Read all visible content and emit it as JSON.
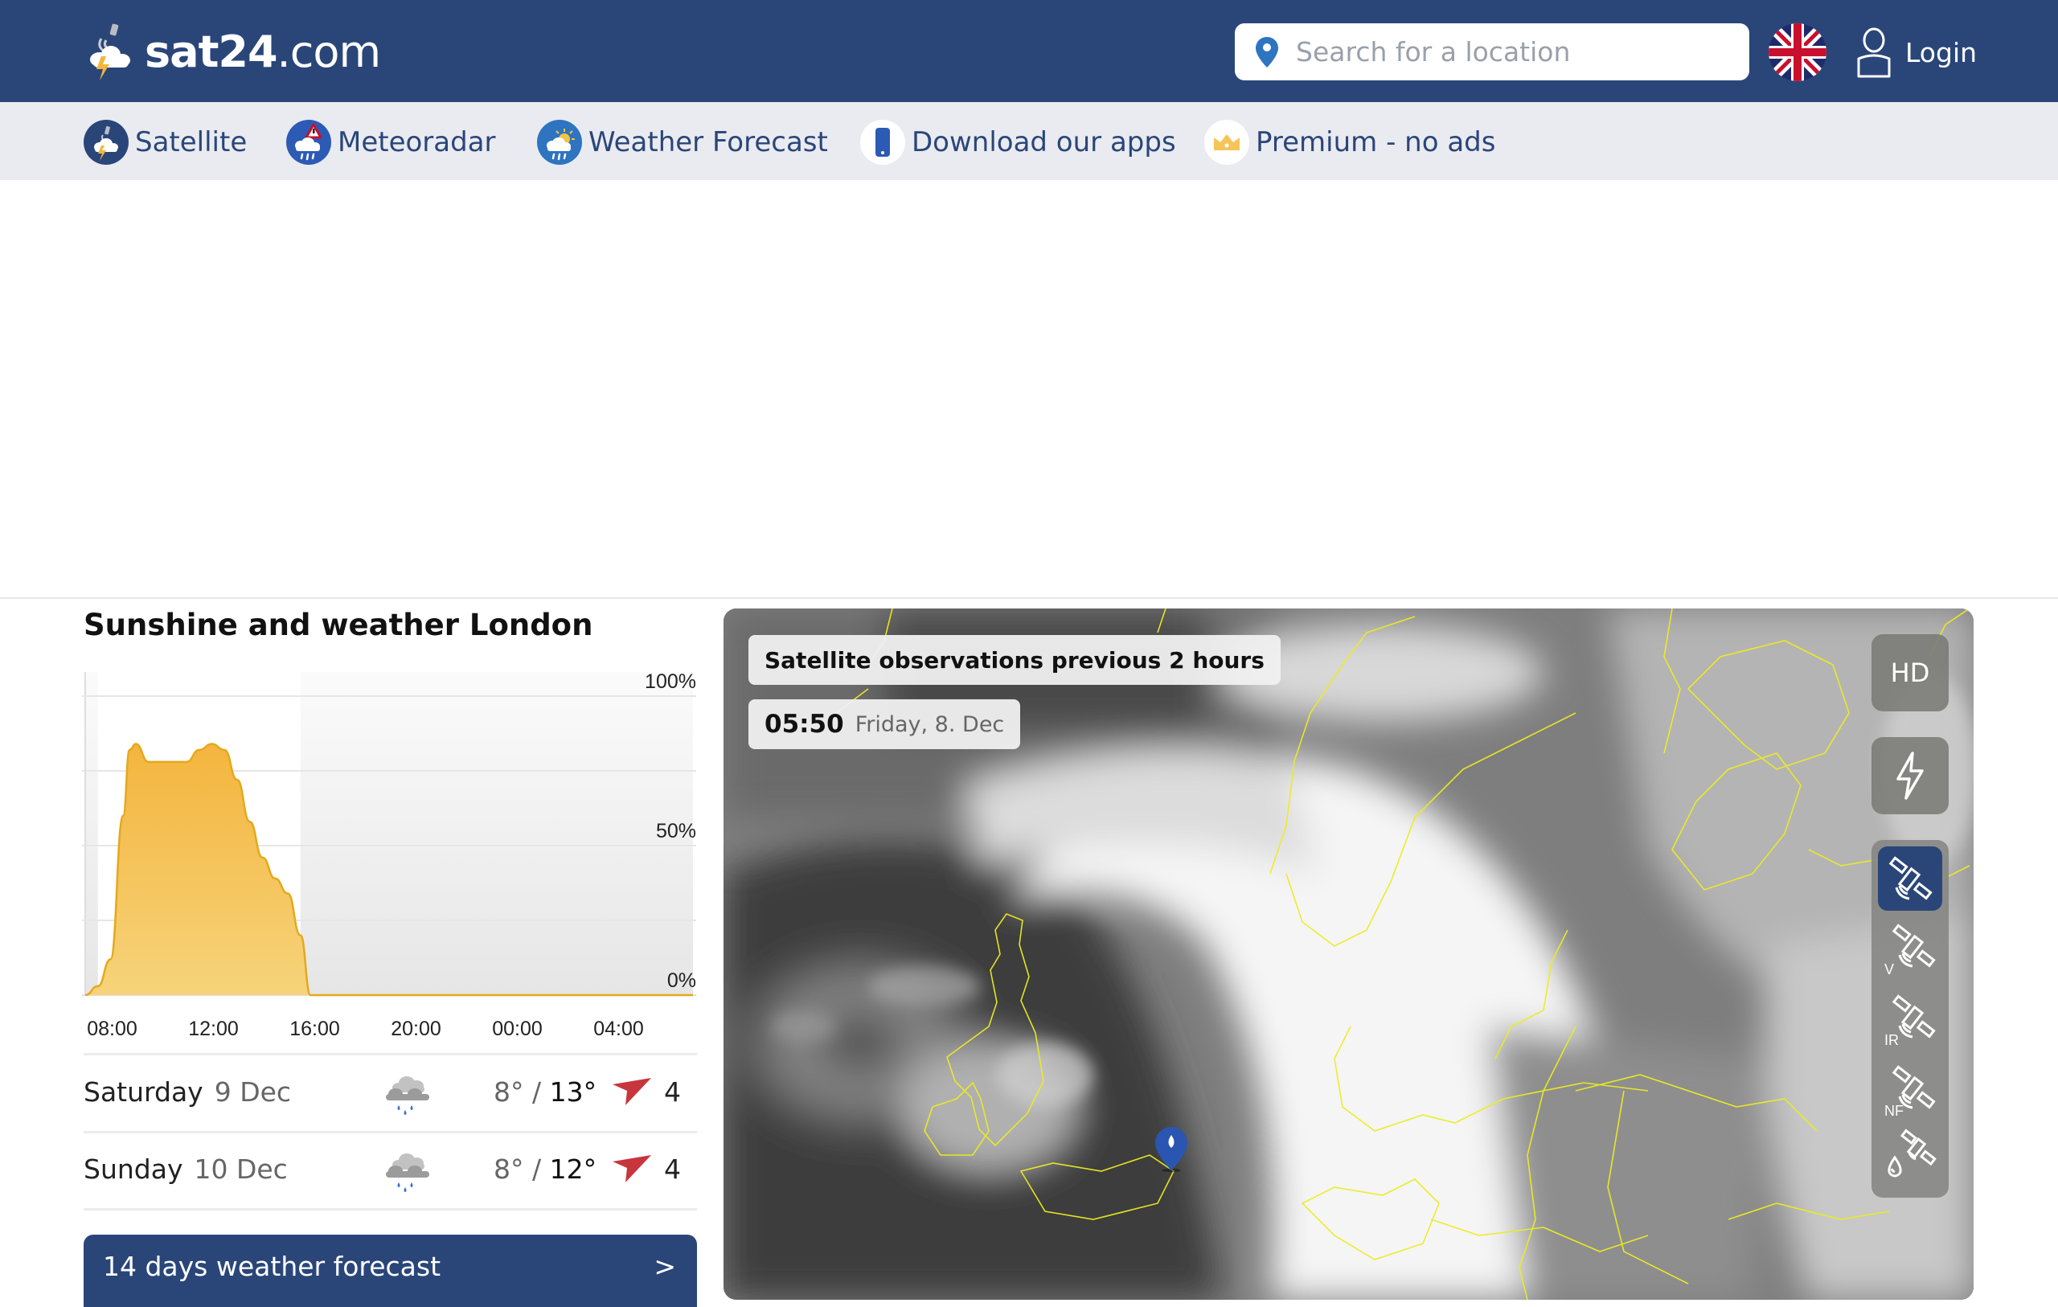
{
  "header": {
    "brand_bold": "sat24",
    "brand_light": ".com",
    "search_placeholder": "Search for a location",
    "language": "English (UK)",
    "login_label": "Login",
    "colors": {
      "header_bg": "#2a4679",
      "nav_bg": "#eaebf0",
      "accent": "#2a4679"
    }
  },
  "nav": {
    "items": [
      {
        "label": "Satellite",
        "icon": "satellite-icon"
      },
      {
        "label": "Meteoradar",
        "icon": "radar-warning-icon"
      },
      {
        "label": "Weather Forecast",
        "icon": "weather-forecast-icon"
      },
      {
        "label": "Download our apps",
        "icon": "phone-icon"
      },
      {
        "label": "Premium - no ads",
        "icon": "crown-icon"
      }
    ]
  },
  "sunshine": {
    "title": "Sunshine and weather London",
    "chart_data": {
      "type": "area",
      "title": "Sunshine and weather London",
      "xlabel": "",
      "ylabel": "",
      "x_ticks": [
        "08:00",
        "12:00",
        "16:00",
        "20:00",
        "00:00",
        "04:00"
      ],
      "y_ticks": [
        "100%",
        "50%",
        "0%"
      ],
      "ylim": [
        0,
        100
      ],
      "grid": true,
      "series": [
        {
          "name": "Sunshine",
          "x_hours": [
            7.0,
            7.5,
            8.0,
            8.5,
            8.75,
            9.0,
            9.5,
            10.0,
            11.0,
            11.5,
            12.0,
            12.5,
            13.0,
            13.5,
            14.0,
            14.5,
            15.0,
            15.5,
            15.9,
            16.0,
            31.0
          ],
          "values": [
            0,
            3,
            12,
            60,
            82,
            84,
            78,
            78,
            78,
            82,
            84,
            82,
            72,
            58,
            46,
            39,
            34,
            20,
            0,
            0,
            0
          ]
        }
      ],
      "daylight_hours": [
        7.5,
        15.5
      ],
      "x_range_hours": [
        7.0,
        31.0
      ]
    }
  },
  "forecast": {
    "days": [
      {
        "day": "Saturday",
        "date": "9 Dec",
        "icon": "rain-cloud-icon",
        "tmin": "8°",
        "sep": " / ",
        "tmax": "13°",
        "wind_speed": "4",
        "wind_dir": "SW"
      },
      {
        "day": "Sunday",
        "date": "10 Dec",
        "icon": "rain-cloud-icon",
        "tmin": "8°",
        "sep": " / ",
        "tmax": "12°",
        "wind_speed": "4",
        "wind_dir": "SW"
      }
    ],
    "button_label": "14 days weather forecast",
    "button_arrow": ">"
  },
  "map": {
    "title": "Satellite observations previous 2 hours",
    "time": "05:50",
    "date": "Friday, 8. Dec",
    "hd_label": "HD",
    "layers": [
      {
        "tag": "",
        "name": "default",
        "active": true
      },
      {
        "tag": "V",
        "name": "visible",
        "active": false
      },
      {
        "tag": "IR",
        "name": "infrared",
        "active": false
      },
      {
        "tag": "NF",
        "name": "natural-color",
        "active": false
      },
      {
        "tag": "",
        "name": "precipitation",
        "active": false
      }
    ],
    "pin_location": "London"
  }
}
